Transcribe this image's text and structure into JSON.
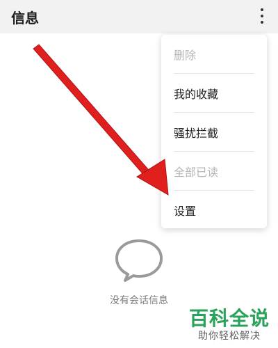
{
  "app_bar": {
    "title": "信息",
    "overflow_icon": "more-vertical-icon"
  },
  "menu": {
    "items": [
      {
        "label": "删除",
        "enabled": false
      },
      {
        "label": "我的收藏",
        "enabled": true
      },
      {
        "label": "骚扰拦截",
        "enabled": true
      },
      {
        "label": "全部已读",
        "enabled": false
      },
      {
        "label": "设置",
        "enabled": true
      }
    ]
  },
  "empty_state": {
    "icon": "chat-bubble-icon",
    "message": "没有会话信息"
  },
  "annotation": {
    "icon": "red-arrow-icon",
    "color": "#e01f1f"
  },
  "watermark": {
    "main": "百科全说",
    "sub": "助你轻松解决",
    "color": "#29a35a"
  }
}
